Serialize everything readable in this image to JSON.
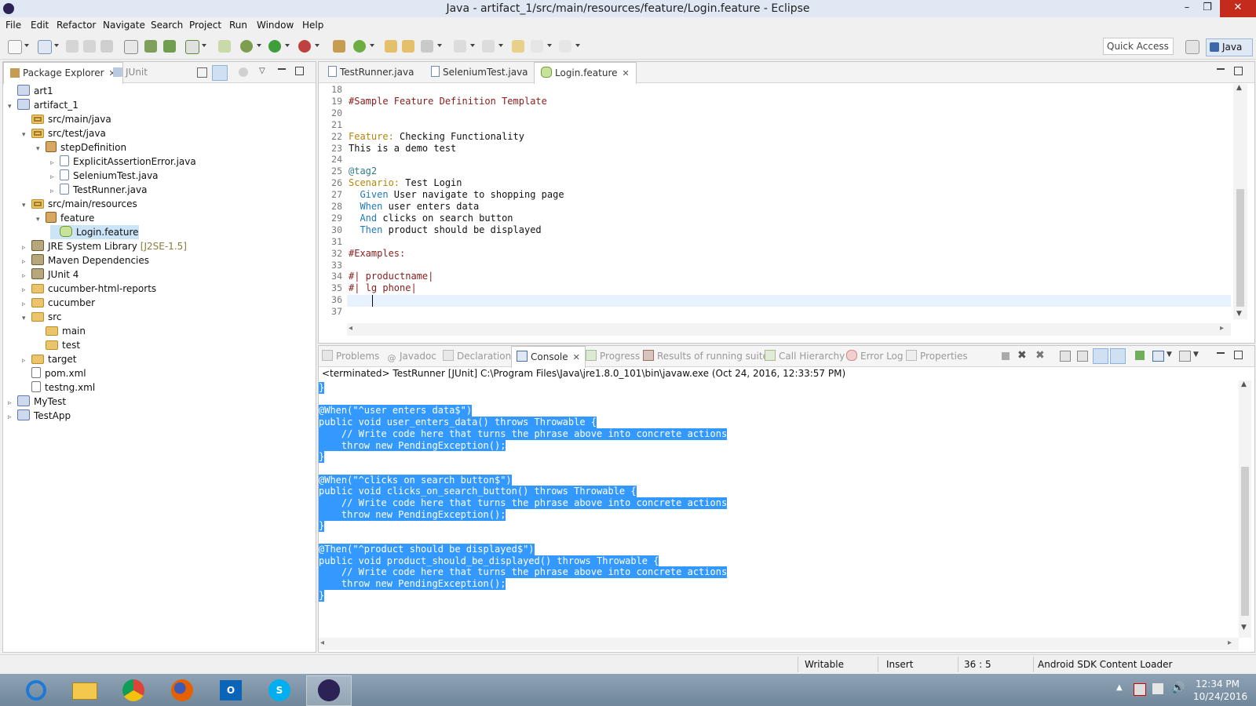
{
  "window": {
    "title": "Java - artifact_1/src/main/resources/feature/Login.feature - Eclipse"
  },
  "menu": [
    "File",
    "Edit",
    "Refactor",
    "Navigate",
    "Search",
    "Project",
    "Run",
    "Window",
    "Help"
  ],
  "toolbar": {
    "quick_access": "Quick Access",
    "perspective": "Java"
  },
  "explorer": {
    "tabs": [
      {
        "label": "Package Explorer"
      },
      {
        "label": "JUnit"
      }
    ],
    "tree": [
      {
        "label": "art1",
        "depth": 0,
        "arrow": "",
        "icon": "project"
      },
      {
        "label": "artifact_1",
        "depth": 0,
        "arrow": "▾",
        "icon": "project"
      },
      {
        "label": "src/main/java",
        "depth": 1,
        "arrow": "",
        "icon": "pkgfolder"
      },
      {
        "label": "src/test/java",
        "depth": 1,
        "arrow": "▾",
        "icon": "pkgfolder"
      },
      {
        "label": "stepDefinition",
        "depth": 2,
        "arrow": "▾",
        "icon": "pkg"
      },
      {
        "label": "ExplicitAssertionError.java",
        "depth": 3,
        "arrow": "▹",
        "icon": "java"
      },
      {
        "label": "SeleniumTest.java",
        "depth": 3,
        "arrow": "▹",
        "icon": "java"
      },
      {
        "label": "TestRunner.java",
        "depth": 3,
        "arrow": "▹",
        "icon": "java"
      },
      {
        "label": "src/main/resources",
        "depth": 1,
        "arrow": "▾",
        "icon": "pkgfolder"
      },
      {
        "label": "feature",
        "depth": 2,
        "arrow": "▾",
        "icon": "pkg"
      },
      {
        "label": "Login.feature",
        "depth": 3,
        "arrow": "",
        "icon": "feature",
        "selected": true
      },
      {
        "label": "JRE System Library",
        "suffix": "[J2SE-1.5]",
        "depth": 1,
        "arrow": "▹",
        "icon": "lib"
      },
      {
        "label": "Maven Dependencies",
        "depth": 1,
        "arrow": "▹",
        "icon": "lib"
      },
      {
        "label": "JUnit 4",
        "depth": 1,
        "arrow": "▹",
        "icon": "lib"
      },
      {
        "label": "cucumber-html-reports",
        "depth": 1,
        "arrow": "▹",
        "icon": "folder"
      },
      {
        "label": "cucumber",
        "depth": 1,
        "arrow": "▹",
        "icon": "folder"
      },
      {
        "label": "src",
        "depth": 1,
        "arrow": "▾",
        "icon": "folder"
      },
      {
        "label": "main",
        "depth": 2,
        "arrow": "",
        "icon": "folder"
      },
      {
        "label": "test",
        "depth": 2,
        "arrow": "",
        "icon": "folder"
      },
      {
        "label": "target",
        "depth": 1,
        "arrow": "▹",
        "icon": "folder"
      },
      {
        "label": "pom.xml",
        "depth": 1,
        "arrow": "",
        "icon": "xml"
      },
      {
        "label": "testng.xml",
        "depth": 1,
        "arrow": "",
        "icon": "xml"
      },
      {
        "label": "MyTest",
        "depth": 0,
        "arrow": "▹",
        "icon": "project"
      },
      {
        "label": "TestApp",
        "depth": 0,
        "arrow": "▹",
        "icon": "project"
      }
    ]
  },
  "editor": {
    "tabs": [
      {
        "label": "TestRunner.java"
      },
      {
        "label": "SeleniumTest.java"
      },
      {
        "label": "Login.feature"
      }
    ],
    "lines": [
      {
        "n": "18",
        "t": ""
      },
      {
        "n": "19",
        "t": "#Sample Feature Definition Template",
        "c": "cm"
      },
      {
        "n": "20",
        "t": ""
      },
      {
        "n": "21",
        "t": ""
      },
      {
        "n": "22",
        "k": "Feature:",
        "t": " Checking Functionality"
      },
      {
        "n": "23",
        "t": "This is a demo test"
      },
      {
        "n": "24",
        "t": ""
      },
      {
        "n": "25",
        "t": "@tag2",
        "c": "tag"
      },
      {
        "n": "26",
        "k": "Scenario:",
        "t": " Test Login"
      },
      {
        "n": "27",
        "k2": "  Given",
        "t": " User navigate to shopping page"
      },
      {
        "n": "28",
        "k2": "  When",
        "t": " user enters data"
      },
      {
        "n": "29",
        "k2": "  And",
        "t": " clicks on search button"
      },
      {
        "n": "30",
        "k2": "  Then",
        "t": " product should be displayed"
      },
      {
        "n": "31",
        "t": ""
      },
      {
        "n": "32",
        "t": "#Examples:",
        "c": "cm"
      },
      {
        "n": "33",
        "t": ""
      },
      {
        "n": "34",
        "t": "#| productname|",
        "c": "cm"
      },
      {
        "n": "35",
        "t": "#| lg phone|",
        "c": "cm"
      },
      {
        "n": "36",
        "t": ""
      },
      {
        "n": "37",
        "t": ""
      }
    ]
  },
  "console": {
    "tabs": [
      {
        "label": "Problems"
      },
      {
        "label": "Javadoc"
      },
      {
        "label": "Declaration"
      },
      {
        "label": "Console"
      },
      {
        "label": "Progress"
      },
      {
        "label": "Results of running suite"
      },
      {
        "label": "Call Hierarchy"
      },
      {
        "label": "Error Log"
      },
      {
        "label": "Properties"
      }
    ],
    "header": "<terminated> TestRunner [JUnit] C:\\Program Files\\Java\\jre1.8.0_101\\bin\\javaw.exe (Oct 24, 2016, 12:33:57 PM)",
    "lines": [
      "}",
      "",
      "@When(\"^user enters data$\")",
      "public void user_enters_data() throws Throwable {",
      "    // Write code here that turns the phrase above into concrete actions",
      "    throw new PendingException();",
      "}",
      "",
      "@When(\"^clicks on search button$\")",
      "public void clicks_on_search_button() throws Throwable {",
      "    // Write code here that turns the phrase above into concrete actions",
      "    throw new PendingException();",
      "}",
      "",
      "@Then(\"^product should be displayed$\")",
      "public void product_should_be_displayed() throws Throwable {",
      "    // Write code here that turns the phrase above into concrete actions",
      "    throw new PendingException();",
      "}",
      ""
    ]
  },
  "status": {
    "writable": "Writable",
    "insert": "Insert",
    "position": "36 : 5",
    "task": "Android SDK Content Loader"
  },
  "taskbar": {
    "time": "12:34 PM",
    "date": "10/24/2016",
    "apps": [
      "internet-explorer-icon",
      "file-explorer-icon",
      "chrome-icon",
      "firefox-icon",
      "outlook-icon",
      "skype-icon",
      "eclipse-icon"
    ]
  }
}
